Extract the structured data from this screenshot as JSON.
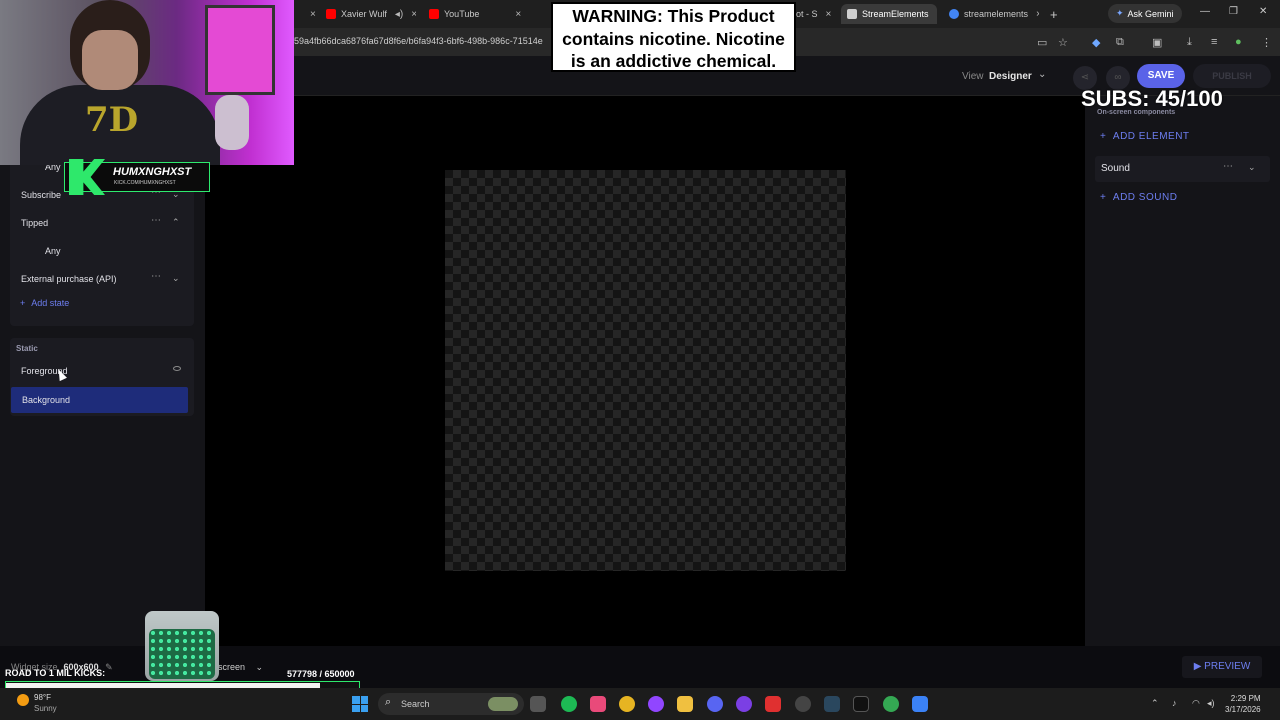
{
  "browser": {
    "tabs": [
      {
        "label": "Xavier Wulf",
        "fav_color": "#ff0000"
      },
      {
        "label": "YouTube",
        "fav_color": "#ff0000"
      },
      {
        "label": "ot - S",
        "fav_color": "#7d3cff"
      },
      {
        "label": "StreamElements",
        "fav_color": "#2d2d2d"
      },
      {
        "label": "streamelements",
        "fav_color": "#4285f4"
      }
    ],
    "ask_gemini": "Ask Gemini",
    "url": "59a4fb66dca6876fa67d8f6e/b6fa94f3-6bf6-498b-986c-71514e"
  },
  "header": {
    "view_label": "View",
    "view_value": "Designer",
    "save": "SAVE",
    "publish": "PUBLISH"
  },
  "left_panel": {
    "states": [
      {
        "label": "Any",
        "indent": true
      },
      {
        "label": "Subscribe",
        "indent": false
      },
      {
        "label": "Tipped",
        "indent": false,
        "expanded": true
      },
      {
        "label": "Any",
        "indent": true
      },
      {
        "label": "External purchase (API)",
        "indent": false
      }
    ],
    "add_state": "Add state",
    "static_header": "Static",
    "static_items": [
      {
        "label": "Foreground",
        "selected": false
      },
      {
        "label": "Background",
        "selected": true
      }
    ]
  },
  "right_panel": {
    "header": "On-screen components",
    "add_element": "ADD ELEMENT",
    "sound_label": "Sound",
    "add_sound": "ADD SOUND"
  },
  "bottom": {
    "widget_size_label": "Widget size",
    "widget_size_value": "600x600",
    "screen_label": "screen",
    "preview": "PREVIEW"
  },
  "overlays": {
    "warning": "WARNING: This Product contains nicotine. Nicotine is an addictive chemical.",
    "subs": "SUBS: 45/100",
    "streamer_name": "HUMXNGHXST",
    "streamer_sub": "KICK.COM/HUMXNGHXST",
    "hoodie_text": "7D",
    "road_label": "ROAD TO 1 MIL KICKS:",
    "kicks_count": "577798  / 650000",
    "kicks_progress": 0.889
  },
  "taskbar": {
    "temp": "98°F",
    "condition": "Sunny",
    "search": "Search",
    "time": "2:29 PM",
    "date": "3/17/2026"
  },
  "colors": {
    "accent": "#5a63e8",
    "link": "#6d7ef0",
    "selected_row": "#1e2c7a",
    "kick_green": "#2ee86b"
  }
}
